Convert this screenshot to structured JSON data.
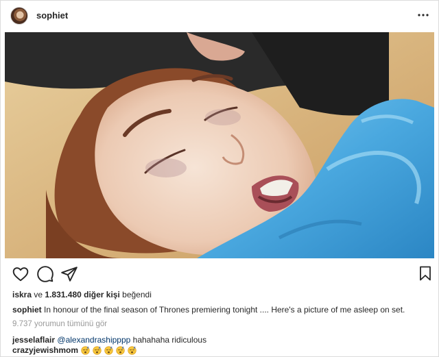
{
  "header": {
    "username": "sophiet",
    "avatar_icon": "profile-avatar",
    "more_icon": "more-options-icon"
  },
  "photo": {
    "subject": "post-photo"
  },
  "actions": {
    "like_icon": "heart-icon",
    "comment_icon": "comment-bubble-icon",
    "share_icon": "paper-plane-icon",
    "save_icon": "bookmark-icon"
  },
  "likes": {
    "first_user": "iskra",
    "connector": "ve",
    "others": "1.831.480 diğer kişi",
    "suffix": "beğendi"
  },
  "caption": {
    "username": "sophiet",
    "text": "In honour of the final season of Thrones premiering tonight .... Here's a picture of me asleep on set."
  },
  "view_all_comments": "9.737 yorumun tümünü gör",
  "comments": [
    {
      "username": "jesselaflair",
      "mention": "@alexandraship​ppp",
      "text": "hahahaha ridiculous"
    },
    {
      "username": "crazyjewishmom",
      "emoji_count": 5,
      "emoji_icon": "sleeping-face-emoji"
    }
  ],
  "colors": {
    "text": "#262626",
    "muted": "#999999",
    "mention": "#003569",
    "border": "#dbdbdb"
  }
}
